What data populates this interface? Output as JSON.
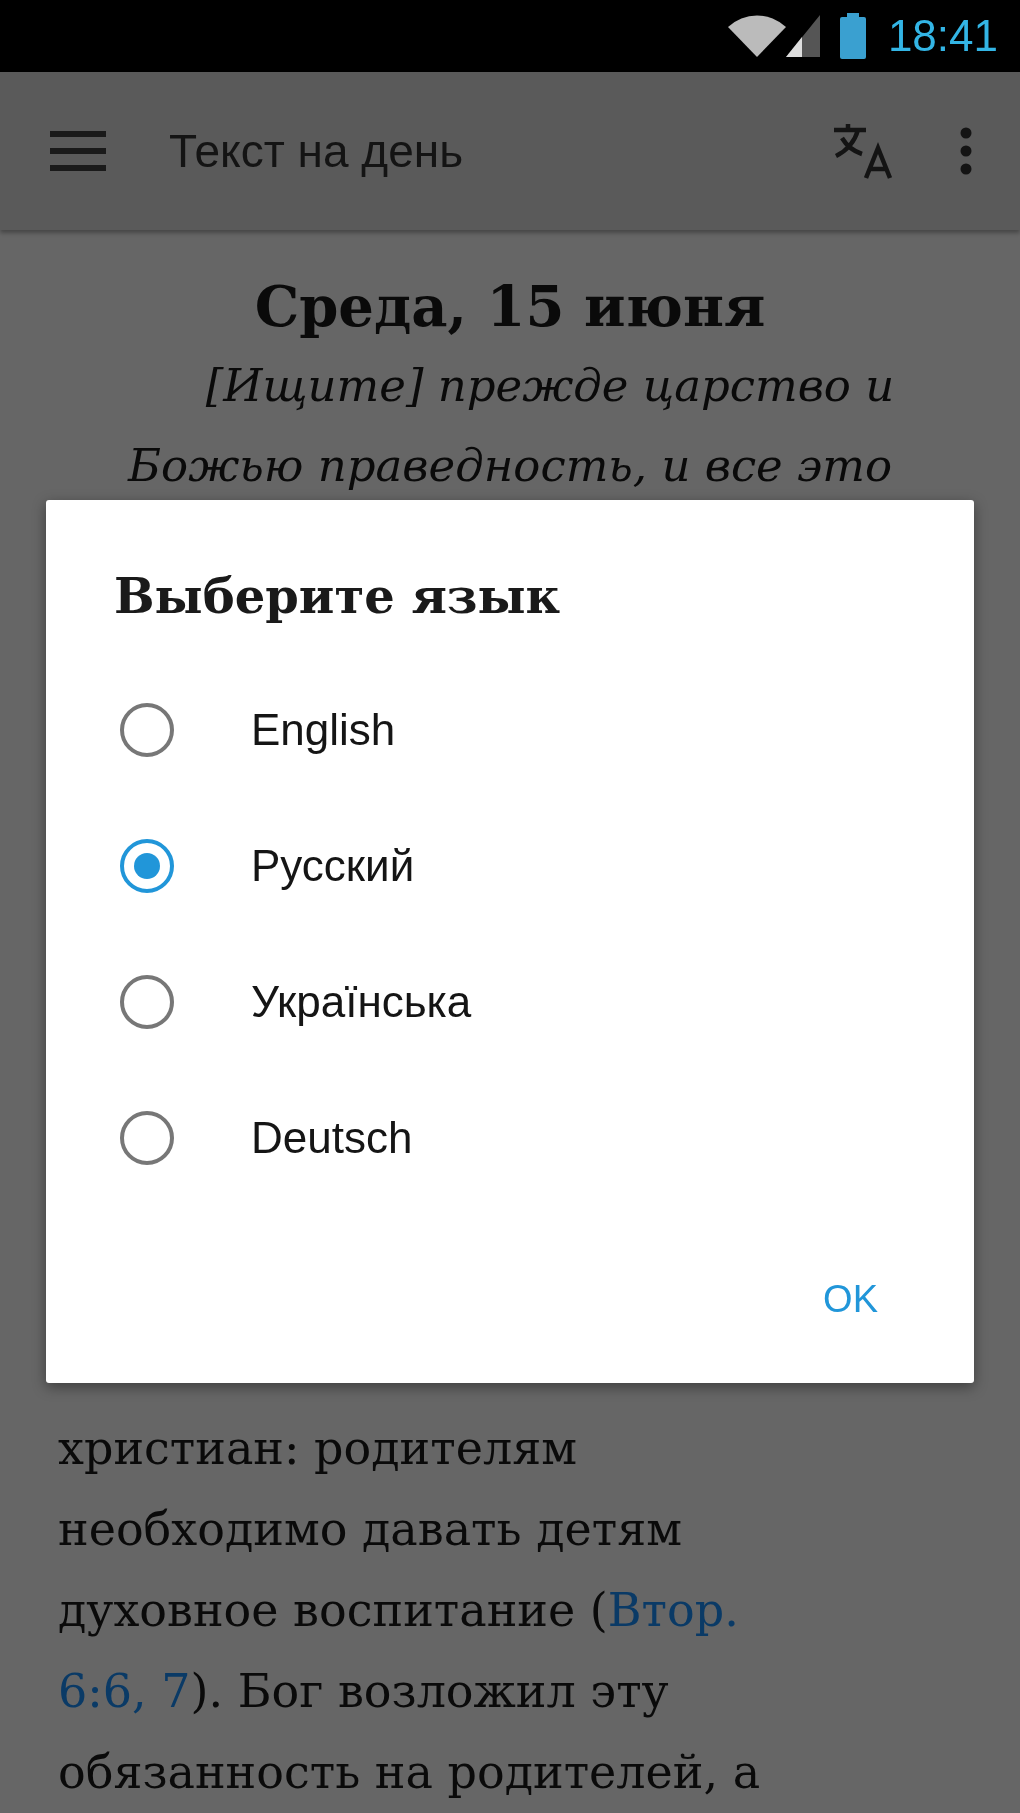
{
  "status_bar": {
    "time": "18:41"
  },
  "toolbar": {
    "title": "Текст на день"
  },
  "article": {
    "date": "Среда, 15 июня",
    "verse_lines": [
      "[Ищите] прежде царство и",
      "Божью праведность, и все это"
    ],
    "body_lines": [
      [
        {
          "kind": "text",
          "text": "христиан: родителям"
        }
      ],
      [
        {
          "kind": "text",
          "text": "необходимо давать детям"
        }
      ],
      [
        {
          "kind": "text",
          "text": "духовное воспитание ("
        },
        {
          "kind": "link",
          "text": "Втор."
        }
      ],
      [
        {
          "kind": "link",
          "text": "6:6, 7"
        },
        {
          "kind": "text",
          "text": "). Бог возложил эту"
        }
      ],
      [
        {
          "kind": "text",
          "text": "обязанность на родителей, а"
        }
      ]
    ]
  },
  "dialog": {
    "title": "Выберите язык",
    "options": [
      {
        "label": "English",
        "selected": false
      },
      {
        "label": "Русский",
        "selected": true
      },
      {
        "label": "Українська",
        "selected": false
      },
      {
        "label": "Deutsch",
        "selected": false
      }
    ],
    "button": "OK"
  }
}
